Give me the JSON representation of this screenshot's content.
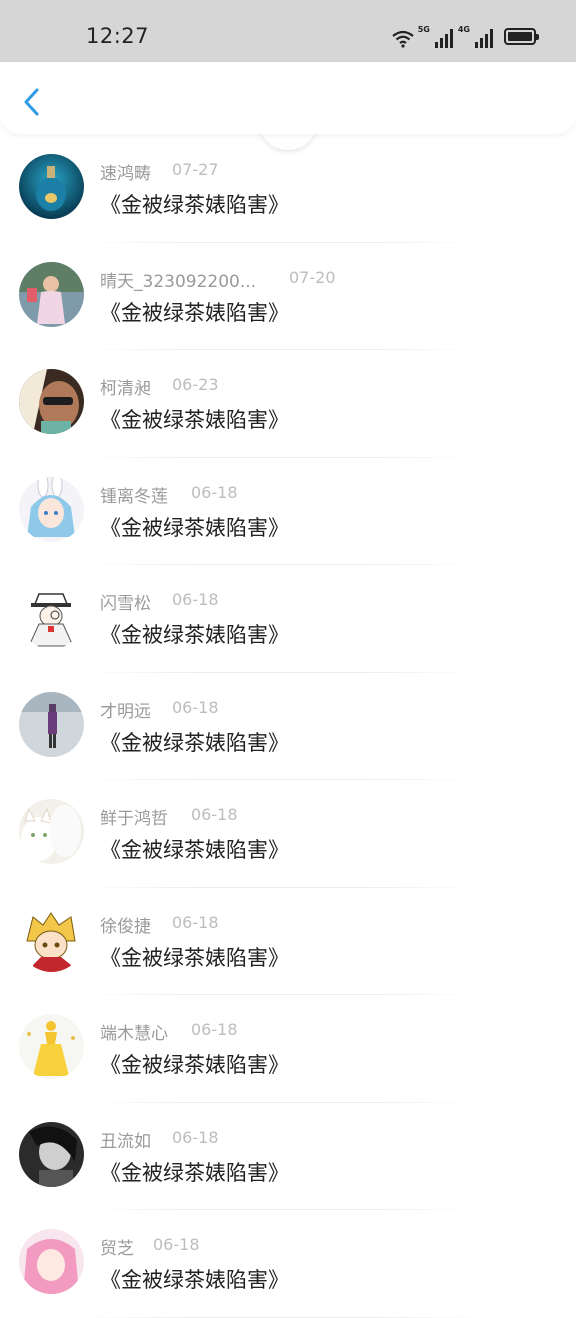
{
  "status_bar": {
    "time": "12:27",
    "network_5g": "5G",
    "network_4g": "4G"
  },
  "nav": {
    "back_icon": "chevron-left-icon",
    "accent_color": "#2e9be6"
  },
  "comments": [
    {
      "user": "速鸿畴",
      "date": "07-27",
      "text": "《金被绿茶婊陷害》"
    },
    {
      "user": "晴天_323092200...",
      "date": "07-20",
      "text": "《金被绿茶婊陷害》"
    },
    {
      "user": "柯清昶",
      "date": "06-23",
      "text": "《金被绿茶婊陷害》"
    },
    {
      "user": "锺离冬莲",
      "date": "06-18",
      "text": "《金被绿茶婊陷害》"
    },
    {
      "user": "闪雪松",
      "date": "06-18",
      "text": "《金被绿茶婊陷害》"
    },
    {
      "user": "才明远",
      "date": "06-18",
      "text": "《金被绿茶婊陷害》"
    },
    {
      "user": "鲜于鸿哲",
      "date": "06-18",
      "text": "《金被绿茶婊陷害》"
    },
    {
      "user": "徐俊捷",
      "date": "06-18",
      "text": "《金被绿茶婊陷害》"
    },
    {
      "user": "端木慧心",
      "date": "06-18",
      "text": "《金被绿茶婊陷害》"
    },
    {
      "user": "丑流如",
      "date": "06-18",
      "text": "《金被绿茶婊陷害》"
    },
    {
      "user": "贸芝",
      "date": "06-18",
      "text": "《金被绿茶婊陷害》"
    }
  ]
}
